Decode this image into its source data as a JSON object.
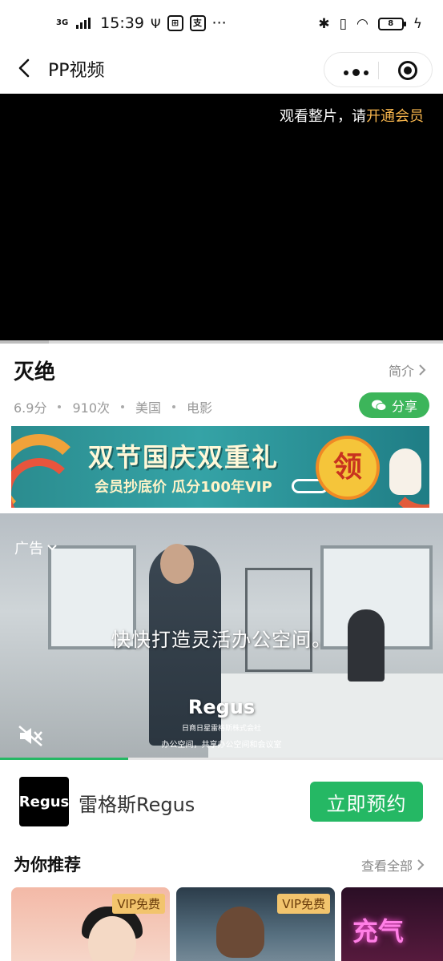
{
  "status_bar": {
    "network": "3G",
    "time": "15:39",
    "icon_1": "支",
    "icon_2": "支",
    "more": "···",
    "battery": "8"
  },
  "nav": {
    "title": "PP视频",
    "back_icon": "chevron-left-icon",
    "more_icon": "more-dots-icon",
    "close_icon": "target-icon"
  },
  "player": {
    "tip_prefix": "观看整片，请",
    "tip_link": "开通会员",
    "progress": 0.11
  },
  "movie": {
    "title": "灭绝",
    "intro_label": "简介",
    "score": "6.9分",
    "plays": "910次",
    "region": "美国",
    "type": "电影",
    "share_label": "分享"
  },
  "banner": {
    "headline": "双节国庆双重礼",
    "subline": "会员抄底价  瓜分100年VIP",
    "badge": "领"
  },
  "ad": {
    "label": "广告",
    "caption": "快快打造灵活办公空间。",
    "logo_text": "Regus",
    "logo_sub": "日商日星雷格斯株式会社",
    "tagline": "办公空间，共享办公空间和会议室",
    "progress": 0.29
  },
  "advertiser": {
    "logo_text": "Regus",
    "name": "雷格斯Regus",
    "cta": "立即预约"
  },
  "recommend": {
    "title": "为你推荐",
    "view_all": "查看全部",
    "cards": [
      {
        "badge": "VIP免费"
      },
      {
        "badge": "VIP免费"
      },
      {
        "neon": "充气"
      }
    ]
  },
  "colors": {
    "vip_link": "#f7b54c",
    "share_green": "#3cb55a",
    "cta_green": "#25b864"
  }
}
